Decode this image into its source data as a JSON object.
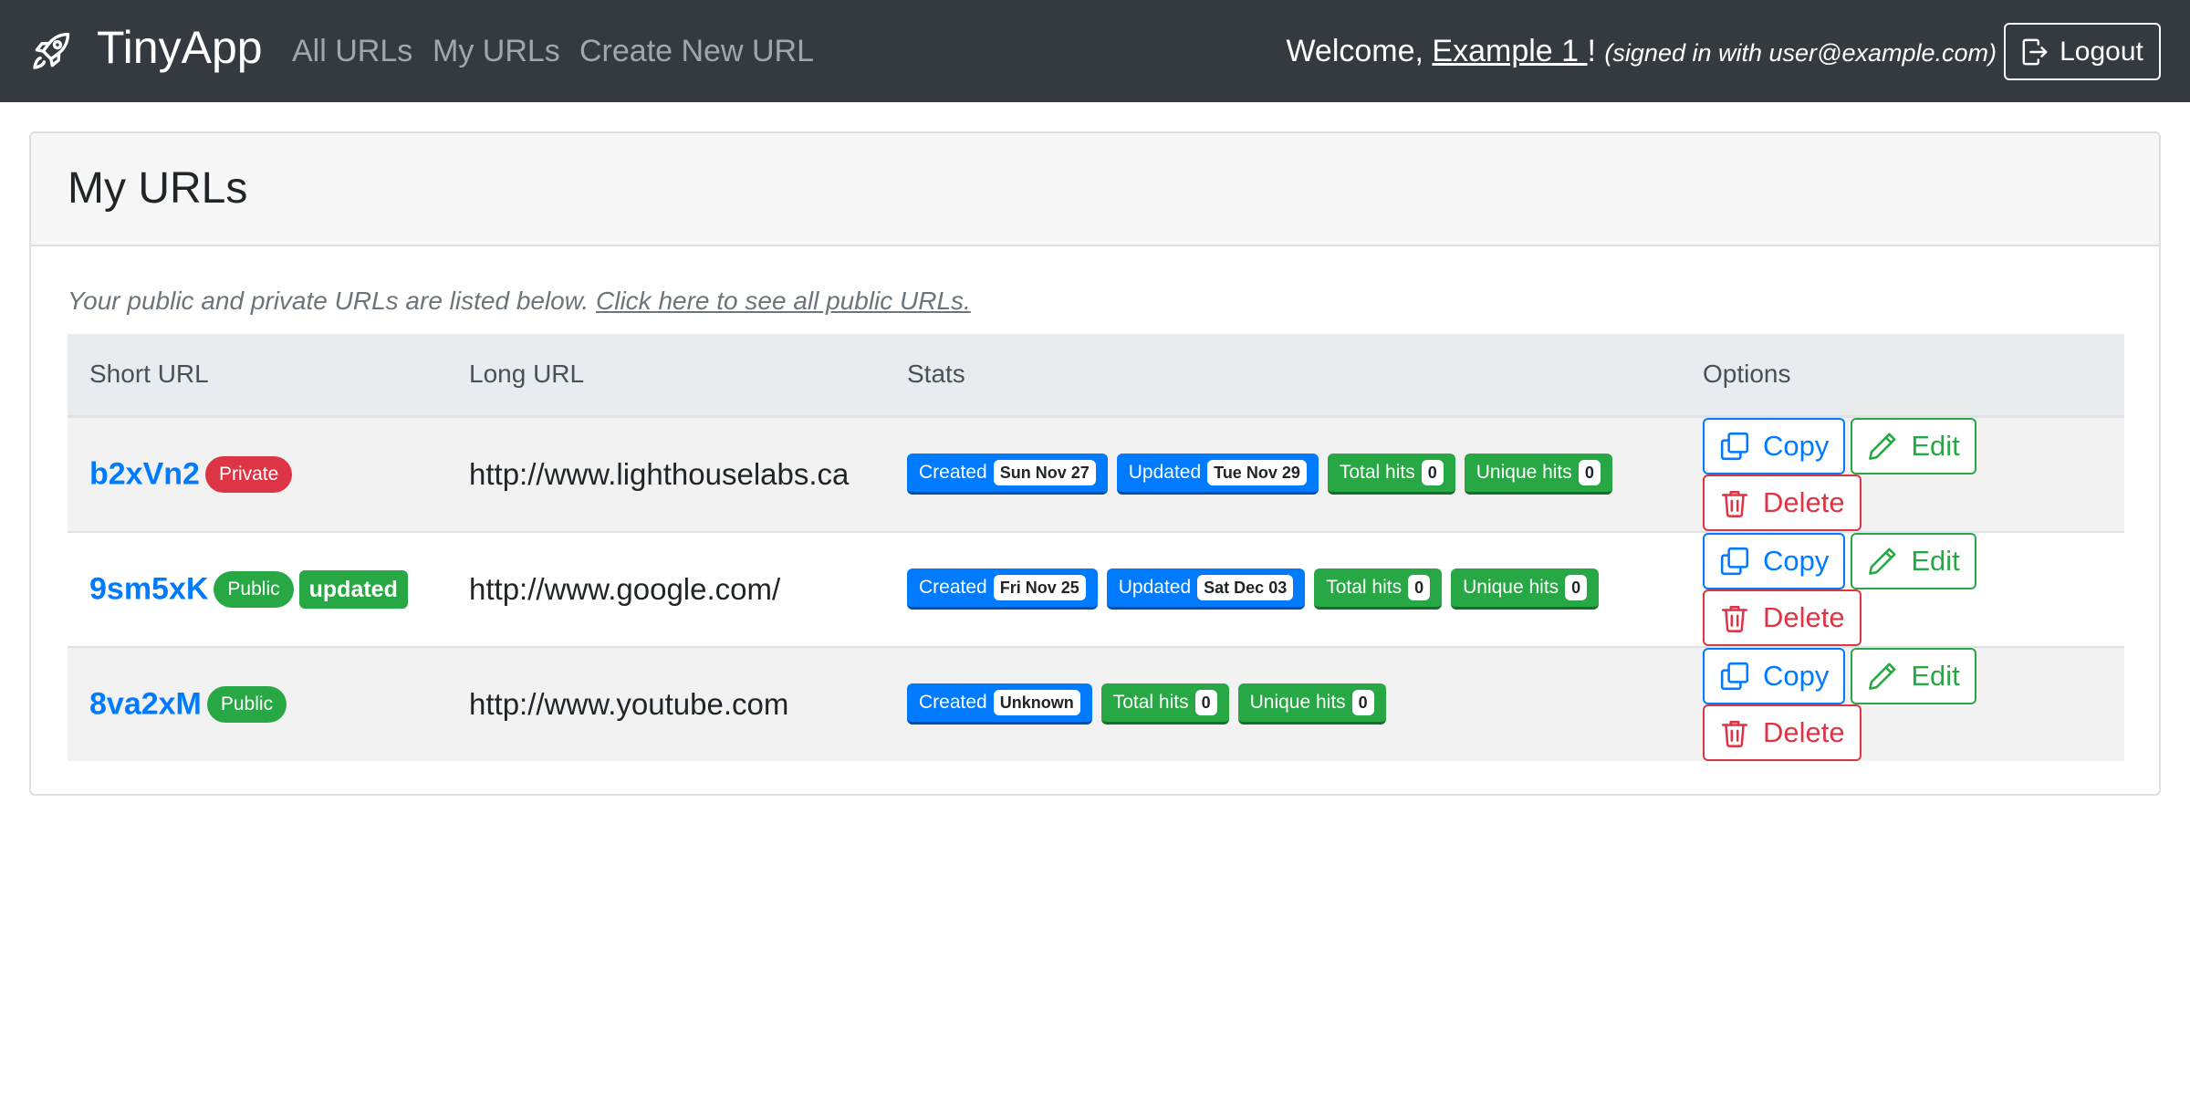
{
  "nav": {
    "brand": "TinyApp",
    "links": [
      "All URLs",
      "My URLs",
      "Create New URL"
    ],
    "welcome_prefix": "Welcome, ",
    "user_name": "Example 1 ",
    "welcome_suffix": "! ",
    "signed_in_text": "(signed in with user@example.com)",
    "logout_label": "Logout"
  },
  "card": {
    "title": "My URLs",
    "intro_text": "Your public and private URLs are listed below. ",
    "intro_link": "Click here to see all public URLs."
  },
  "table": {
    "headers": [
      "Short URL",
      "Long URL",
      "Stats",
      "Options"
    ],
    "rows": [
      {
        "short_url": "b2xVn2",
        "visibility": "Private",
        "updated_tag": "",
        "long_url": "http://www.lighthouselabs.ca",
        "created_label": "Created",
        "created": "Sun Nov 27",
        "updated_label": "Updated",
        "updated": "Tue Nov 29",
        "total_label": "Total hits",
        "total_hits": "0",
        "unique_label": "Unique hits",
        "unique_hits": "0"
      },
      {
        "short_url": "9sm5xK",
        "visibility": "Public",
        "updated_tag": "updated",
        "long_url": "http://www.google.com/",
        "created_label": "Created",
        "created": "Fri Nov 25",
        "updated_label": "Updated",
        "updated": "Sat Dec 03",
        "total_label": "Total hits",
        "total_hits": "0",
        "unique_label": "Unique hits",
        "unique_hits": "0"
      },
      {
        "short_url": "8va2xM",
        "visibility": "Public",
        "updated_tag": "",
        "long_url": "http://www.youtube.com",
        "created_label": "Created",
        "created": "Unknown",
        "total_label": "Total hits",
        "total_hits": "0",
        "unique_label": "Unique hits",
        "unique_hits": "0"
      }
    ],
    "options": {
      "copy_label": "Copy",
      "edit_label": "Edit",
      "delete_label": "Delete"
    }
  },
  "icons": {
    "brand": "rocket-icon",
    "logout": "box-arrow-right-icon",
    "copy": "copy-icon",
    "edit": "pencil-icon",
    "delete": "trash-icon"
  },
  "colors": {
    "navbar": "#343a40",
    "primary": "#007bff",
    "success": "#28a745",
    "danger": "#dc3545"
  }
}
